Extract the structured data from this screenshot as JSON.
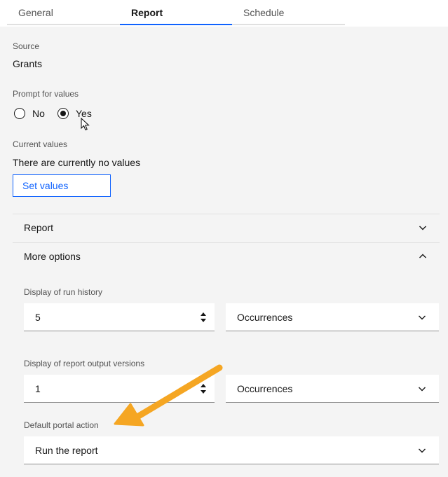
{
  "tabs": [
    {
      "label": "General"
    },
    {
      "label": "Report"
    },
    {
      "label": "Schedule"
    }
  ],
  "source": {
    "label": "Source",
    "value": "Grants"
  },
  "prompt": {
    "label": "Prompt for values",
    "options": [
      {
        "label": "No",
        "checked": false
      },
      {
        "label": "Yes",
        "checked": true
      }
    ]
  },
  "current_values": {
    "label": "Current values",
    "text": "There are currently no values",
    "button": "Set values"
  },
  "accordion": {
    "report": {
      "title": "Report",
      "expanded": false
    },
    "more_options": {
      "title": "More options",
      "expanded": true
    }
  },
  "run_history": {
    "label": "Display of run history",
    "value": "5",
    "unit": "Occurrences"
  },
  "output_versions": {
    "label": "Display of report output versions",
    "value": "1",
    "unit": "Occurrences"
  },
  "portal_action": {
    "label": "Default portal action",
    "value": "Run the report"
  },
  "colors": {
    "accent": "#0f62fe",
    "annotation_arrow": "#f5a623"
  }
}
